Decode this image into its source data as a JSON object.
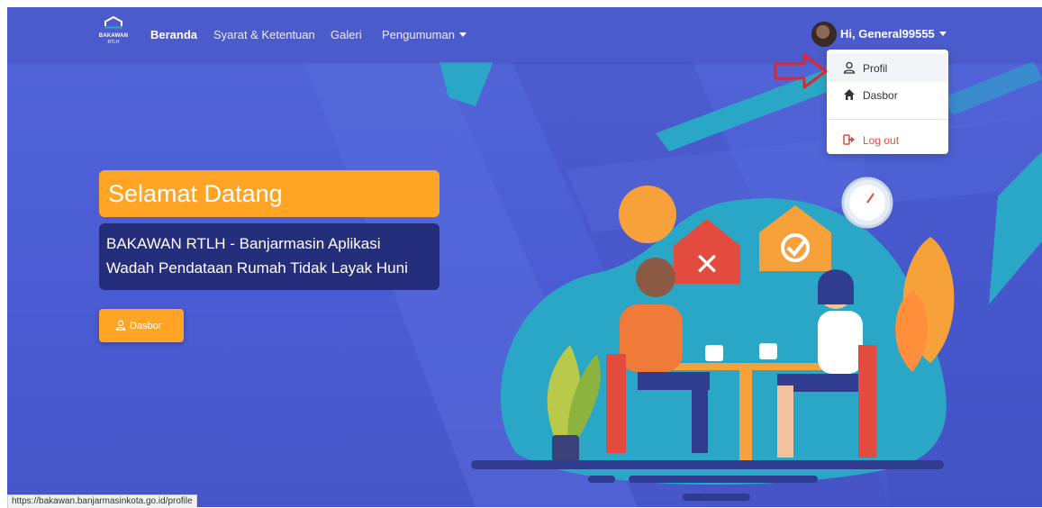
{
  "brand": {
    "logo_line1": "BAKAWAN",
    "logo_line2": "RTLH"
  },
  "nav": {
    "items": [
      {
        "label": "Beranda",
        "active": true
      },
      {
        "label": "Syarat & Ketentuan",
        "active": false
      },
      {
        "label": "Galeri",
        "active": false
      },
      {
        "label": "Pengumuman",
        "active": false,
        "has_caret": true
      }
    ]
  },
  "user": {
    "greeting": "Hi, General99555",
    "avatar_icon": "user-avatar"
  },
  "dropdown": {
    "items": [
      {
        "label": "Profil",
        "icon": "user-icon"
      },
      {
        "label": "Dasbor",
        "icon": "home-icon"
      },
      {
        "label": "Log out",
        "icon": "sign-out-icon"
      }
    ]
  },
  "hero": {
    "title": "Selamat Datang",
    "subtitle_line1": "BAKAWAN RTLH - Banjarmasin Aplikasi",
    "subtitle_line2": "Wadah Pendataan Rumah Tidak Layak Huni",
    "button_label": "Dasbor"
  },
  "status_url": "https://bakawan.banjarmasinkota.go.id/profile",
  "colors": {
    "primary": "#4c5bcc",
    "accent": "#ffa424",
    "dark_box": "#252e7a",
    "teal": "#2aa7c7",
    "annotation_red": "#e0252b"
  }
}
